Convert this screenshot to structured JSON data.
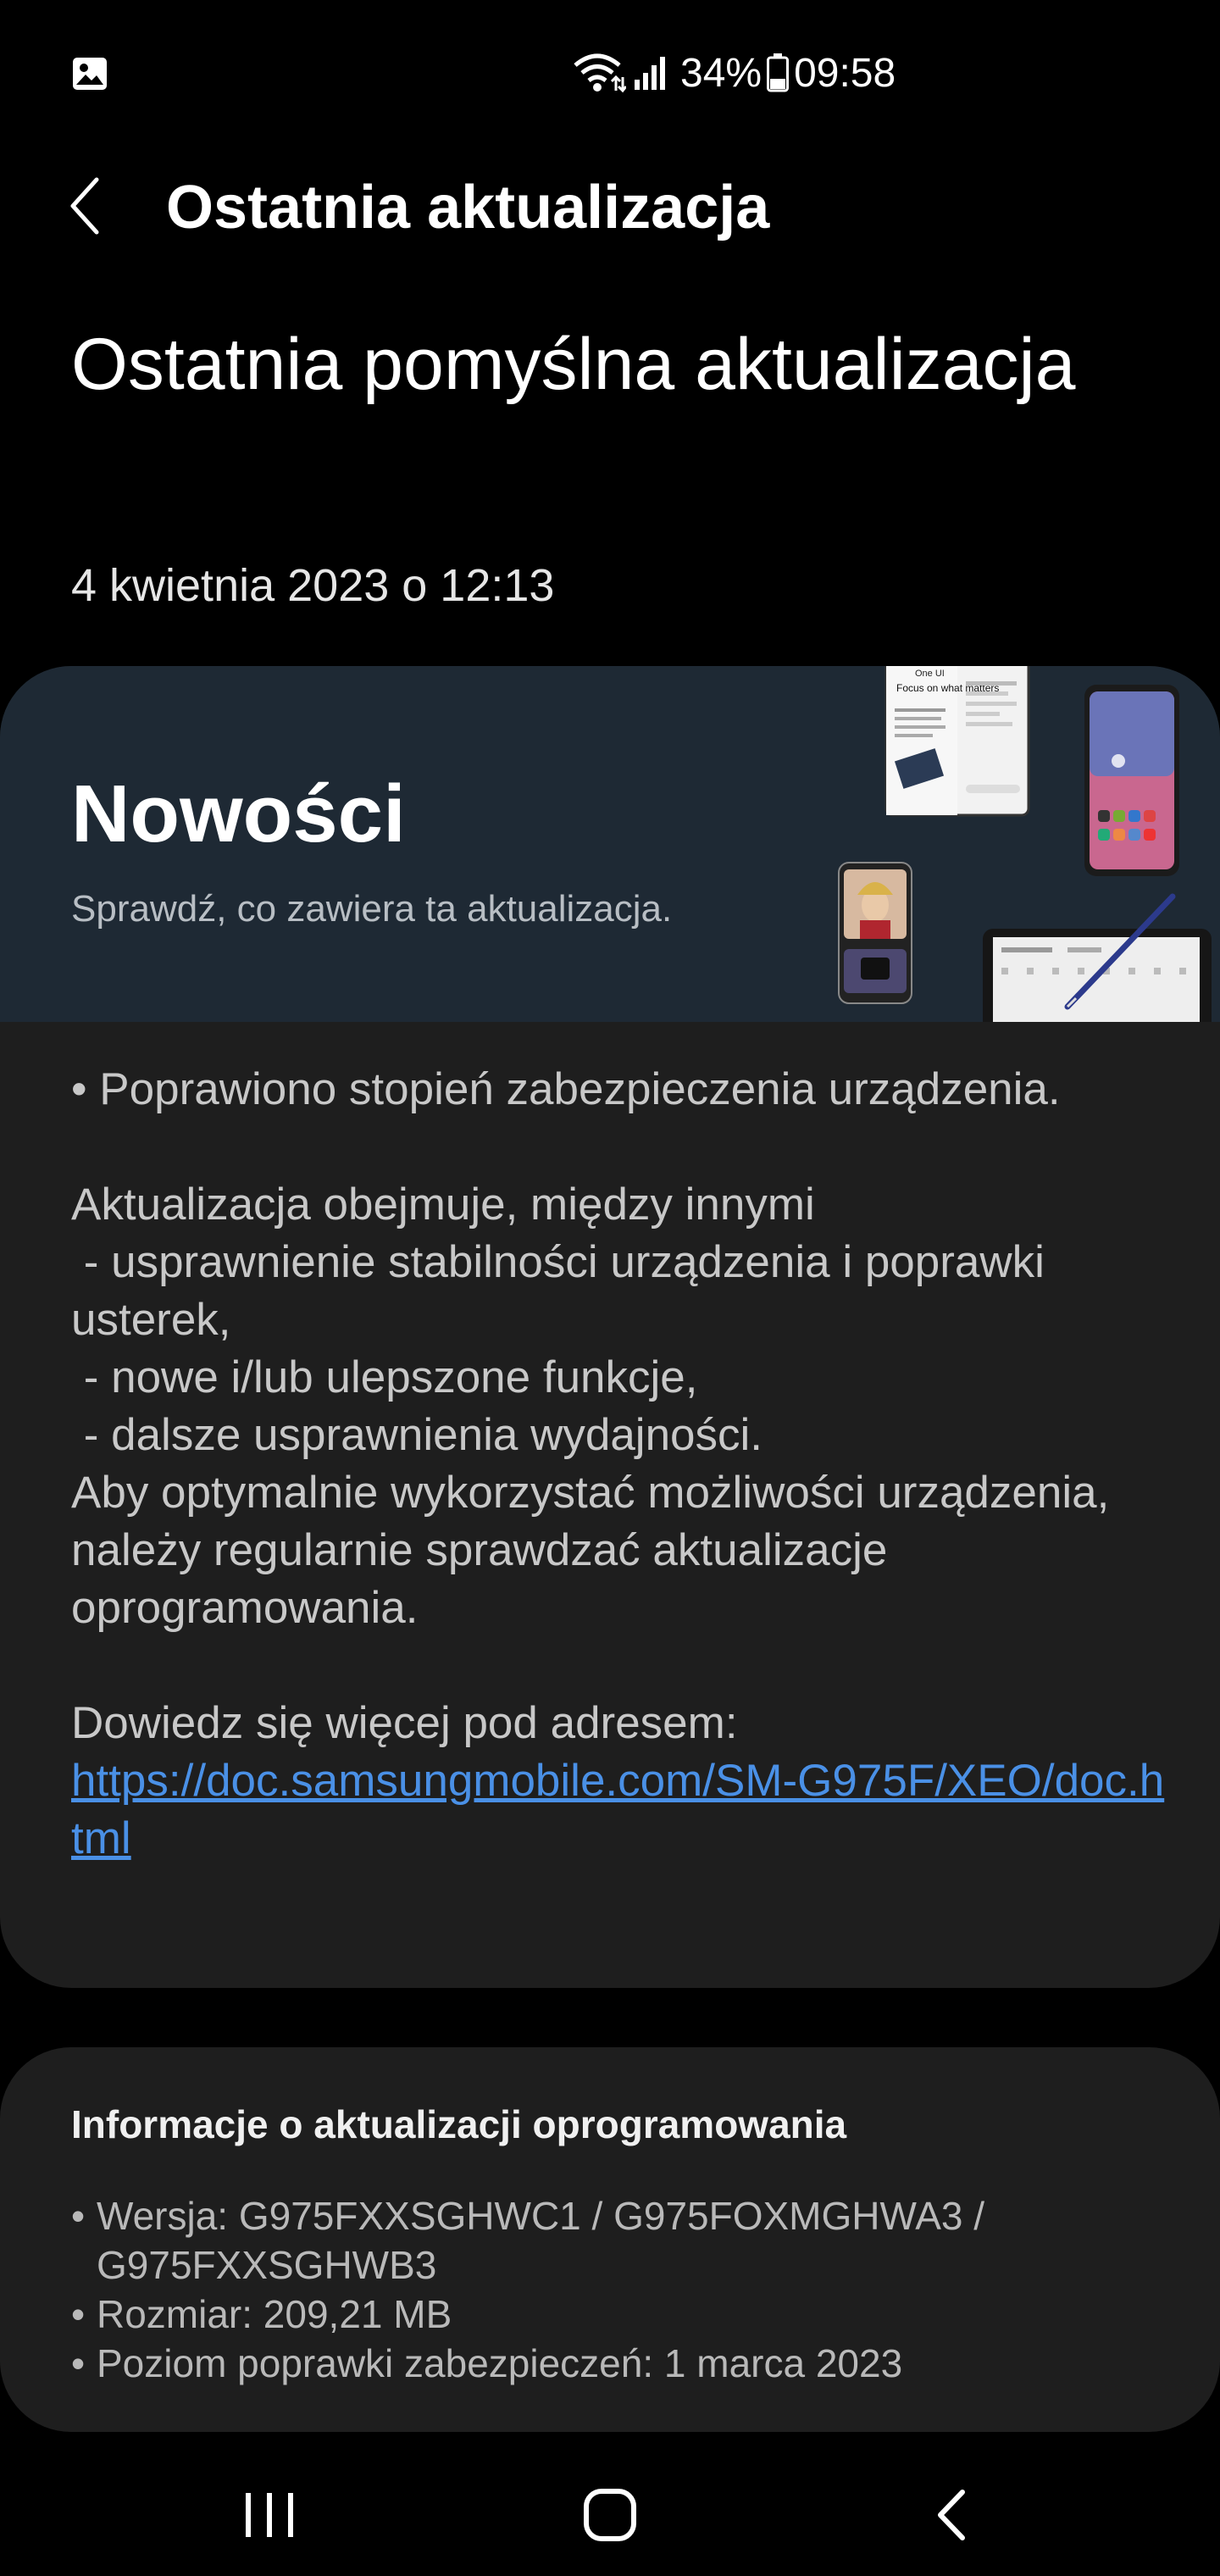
{
  "status_bar": {
    "battery": "34%",
    "time": "09:58",
    "icons": [
      "gallery-notification-icon",
      "wifi-icon",
      "signal-icon",
      "battery-icon"
    ]
  },
  "app_bar": {
    "title": "Ostatnia aktualizacja",
    "back_icon": "chevron-left-icon"
  },
  "hero": {
    "title": "Ostatnia pomyślna aktualizacja",
    "date": "4 kwietnia 2023 o 12:13"
  },
  "news": {
    "title": "Nowości",
    "subtitle": "Sprawdź, co zawiera ta aktualizacja.",
    "illustration": "devices-illustration",
    "illustration_text": [
      "One UI",
      "Focus on what matters"
    ],
    "body": "• Poprawiono stopień zabezpieczenia urządzenia.\n\nAktualizacja obejmuje, między innymi\n - usprawnienie stabilności urządzenia i poprawki usterek,\n - nowe i/lub ulepszone funkcje,\n - dalsze usprawnienia wydajności.\nAby optymalnie wykorzystać możliwości urządzenia, należy regularnie sprawdzać aktualizacje oprogramowania.\n\nDowiedz się więcej pod adresem:",
    "link": "https://doc.samsungmobile.com/SM-G975F/XEO/doc.html"
  },
  "software_info": {
    "title": "Informacje o aktualizacji oprogramowania",
    "items": [
      "Wersja: G975FXXSGHWC1 / G975FOXMGHWA3 / G975FXXSGHWB3",
      "Rozmiar: 209,21 MB",
      "Poziom poprawki zabezpieczeń: 1 marca 2023"
    ]
  },
  "nav_bar": {
    "buttons": [
      "recent-apps-icon",
      "home-icon",
      "back-icon"
    ]
  },
  "colors": {
    "background": "#000000",
    "card": "#1e1e1e",
    "banner": "#1e2934",
    "link": "#4a90e6"
  }
}
